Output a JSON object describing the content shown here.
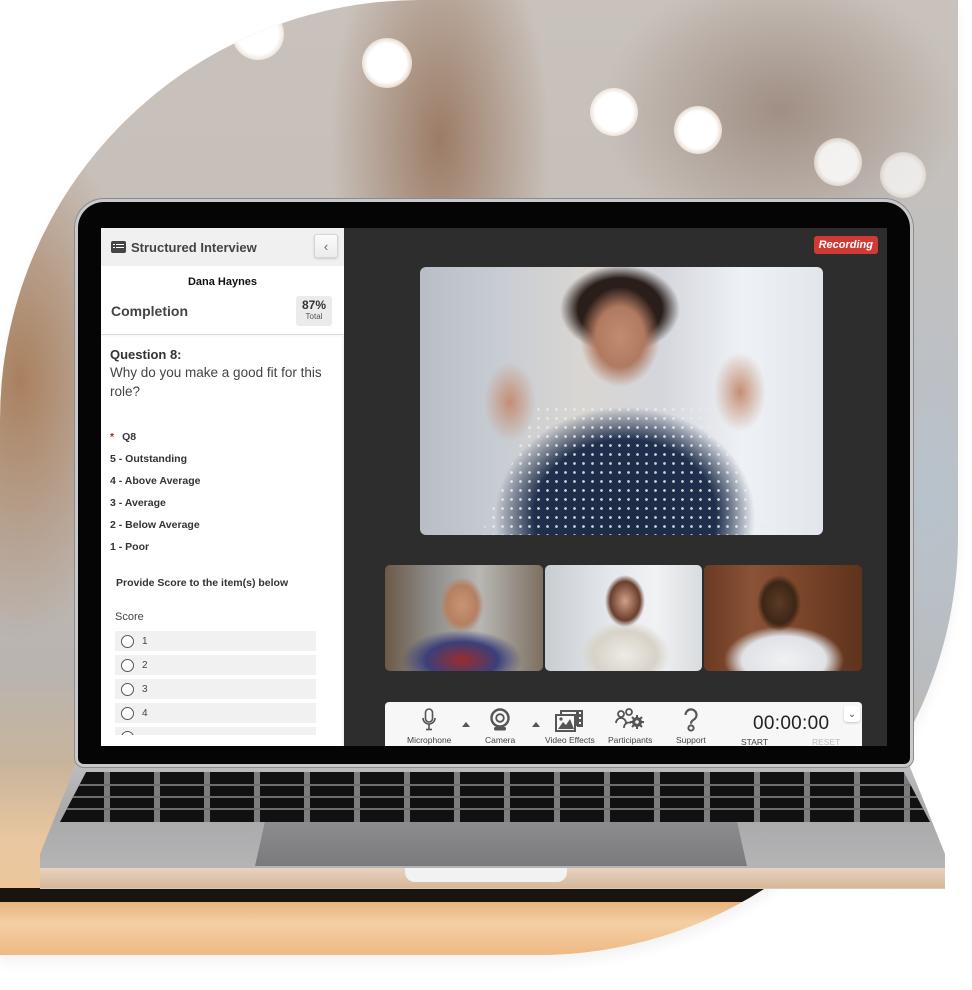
{
  "sidebar": {
    "title": "Structured Interview",
    "collapse_glyph": "‹",
    "candidate_name": "Dana Haynes",
    "completion_label": "Completion",
    "completion_percent": "87%",
    "completion_sub": "Total",
    "question_title": "Question 8:",
    "question_text": "Why do you make a good fit for this role?",
    "required_marker": "*",
    "question_code": "Q8",
    "scale": [
      "5 - Outstanding",
      "4 - Above Average",
      "3 - Average",
      "2 - Below Average",
      "1 - Poor"
    ],
    "instruction": "Provide Score to the item(s) below",
    "score_label": "Score",
    "score_options": [
      "1",
      "2",
      "3",
      "4"
    ]
  },
  "main": {
    "recording_badge": "Recording",
    "recording_color": "#d03a34",
    "main_participant": "interviewee-video",
    "thumbnails": [
      "participant-1",
      "participant-2",
      "participant-3"
    ]
  },
  "controls": {
    "items": [
      {
        "label": "Microphone",
        "icon": "microphone-icon"
      },
      {
        "label": "Camera",
        "icon": "webcam-icon"
      },
      {
        "label": "Video Effects",
        "icon": "video-effects-icon"
      },
      {
        "label": "Participants",
        "icon": "participants-settings-icon"
      },
      {
        "label": "Support",
        "icon": "question-icon"
      }
    ],
    "timer": "00:00:00",
    "start_label": "START",
    "reset_label": "RESET",
    "expand_glyph": "⌄"
  }
}
